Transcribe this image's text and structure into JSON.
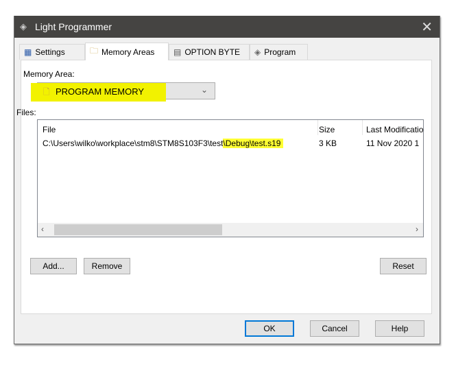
{
  "window": {
    "title": "Light Programmer",
    "close_icon": "close-icon",
    "title_icon": "chip-icon"
  },
  "tabs": [
    {
      "label": "Settings",
      "icon": "settings-icon",
      "active": false
    },
    {
      "label": "Memory Areas",
      "icon": "memory-areas-icon",
      "active": true
    },
    {
      "label": "OPTION BYTE",
      "icon": "option-byte-icon",
      "active": false
    },
    {
      "label": "Program",
      "icon": "chip-icon",
      "active": false
    }
  ],
  "memory_area": {
    "label": "Memory Area:",
    "selected": "PROGRAM MEMORY"
  },
  "files": {
    "label": "Files:",
    "columns": [
      "File",
      "Size",
      "Last Modificatio"
    ],
    "rows": [
      {
        "file_prefix": "C:\\Users\\wilko\\workplace\\stm8\\STM8S103F3\\test",
        "file_highlight": "\\Debug\\test.s19",
        "size": "3 KB",
        "modified": "11 Nov 2020 1"
      }
    ]
  },
  "buttons": {
    "add": "Add...",
    "remove": "Remove",
    "reset": "Reset",
    "ok": "OK",
    "cancel": "Cancel",
    "help": "Help"
  },
  "colors": {
    "highlight": "#ffff33",
    "titlebar": "#454442",
    "accent": "#0078d7"
  }
}
